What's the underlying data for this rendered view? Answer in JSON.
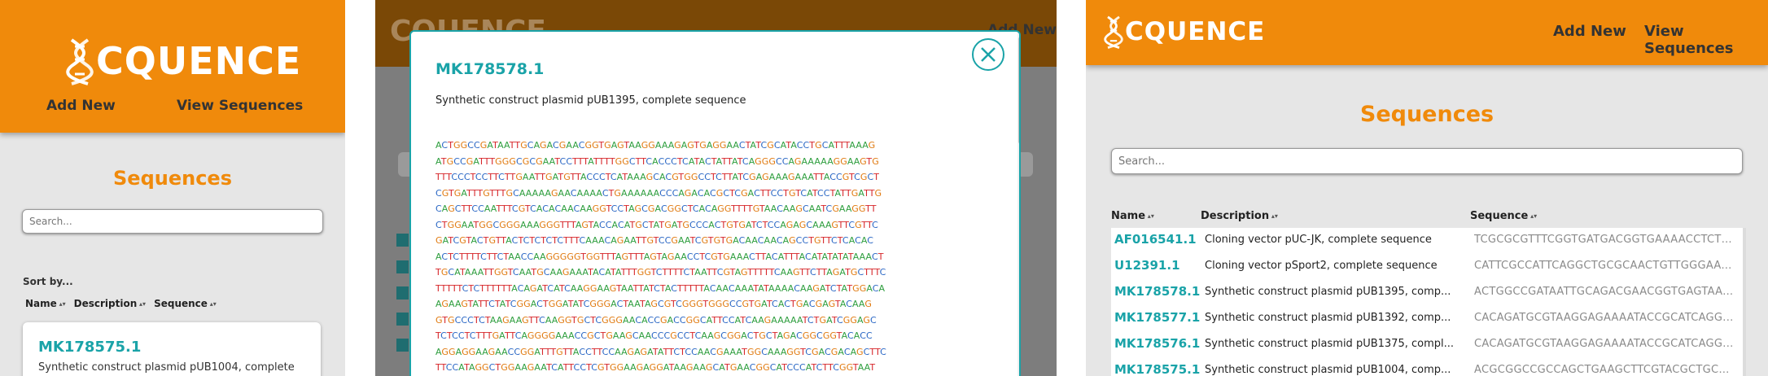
{
  "brand": {
    "name": "CQUENCE",
    "accent": "#f08a0b",
    "teal": "#1aa3a8"
  },
  "nav": {
    "add_new": "Add New",
    "view_sequences": "View Sequences"
  },
  "page": {
    "title": "Sequences",
    "search_placeholder": "Search..."
  },
  "sort": {
    "label": "Sort by...",
    "name": "Name",
    "description": "Description",
    "sequence": "Sequence"
  },
  "mobile_card": {
    "name": "MK178575.1",
    "description": "Synthetic construct plasmid pUB1004, complete"
  },
  "modal": {
    "name": "MK178578.1",
    "description": "Synthetic construct plasmid pUB1395, complete sequence",
    "sequence_lines": [
      "ACTGGCCGATAATTGCAGACGAACGGTGAGTAAGGAAAGAGTGAGGAACTATCGCATACCTGCATTTAAAG",
      "ATGCCGATTTGGGCGCGAATCCTTTATTTTGGCTTCACCCTCATACTATTATCAGGGCCAGAAAAAGGAAGTG",
      "TTTCCCTCCTTCTTGAATTGATGTTACCCTCATAAAGCACGTGGCCTCTTATCGAGAAAGAAATTACCGTCGCT",
      "CGTGATTTGTTTGCAAAAAGAACAAAACTGAAAAAACCCAGACACGCTCGACTTCCTGTCATCCTATTGATTG",
      "CAGCTTCCAATTTCGTCACACAACAAGGTCCTAGCGACGGCTCACAGGTTTTGTAACAAGCAATCGAAGGTT",
      "CTGGAATGGCGGGAAAGGGTTTAGTACCACATGCTATGATGCCCACTGTGATCTCCAGAGCAAAGTTCGTTC",
      "GATCGTACTGTTACTCTCTCTCTTTCAAACAGAATTGTCCGAATCGTGTGACAACAACAGCCTGTTCTCACAC",
      "ACTCTTTTCTTCTAACCAAGGGGGTGGTTTAGTTTAGTAGAACCTCGTGAAACTTACATTTACATATATATAAACT",
      "TGCATAAATTGGTCAATGCAAGAAATACATATTTGGTCTTTTCTAATTCGTAGTTTTTCAAGTTCTTAGATGCTTTC",
      "TTTTTCTCTTTTTTACAGATCATCAAGGAAGTAATTATCTACTTTTTACAACAAATATAAAACAAGATCTATGGACA",
      "AGAAGTATTCTATCGGACTGGATATCGGGACTAATAGCGTCGGGTGGGCCGTGATCACTGACGAGTACAAG",
      "GTGCCCTCTAAGAAGTTCAAGGTGCTCGGGAACACCGACCGGCATTCCATCAAGAAAAATCTGATCGGAGC",
      "TCTCCTCTTTGATTCAGGGGAAACCGCTGAAGCAACCCGCCTCAAGCGGACTGCTAGACGGCGGTACACC",
      "AGGAGGAAGAACCGGATTTGTTACCTTCCAAGAGATATTCTCCAACGAAATGGCAAAGGTCGACGACAGCTTC",
      "TTCCATAGGCTGGAAGAATCATTCCTCGTGGAAGAGGATAAGAAGCATGAACGGCATCCCATCTTCGGTAAT"
    ]
  },
  "table": {
    "headers": {
      "name": "Name",
      "description": "Description",
      "sequence": "Sequence"
    },
    "rows": [
      {
        "name": "AF016541.1",
        "description": "Cloning vector pUC-JK, complete sequence",
        "sequence": "TCGCGCGTTTCGGTGATGACGGTGAAAACCTCTG..."
      },
      {
        "name": "U12391.1",
        "description": "Cloning vector pSport2, complete sequence",
        "sequence": "CATTCGCCATTCAGGCTGCGCAACTGTTGGGAAG..."
      },
      {
        "name": "MK178578.1",
        "description": "Synthetic construct plasmid pUB1395, comp...",
        "sequence": "ACTGGCCGATAATTGCAGACGAACGGTGAGTAAG..."
      },
      {
        "name": "MK178577.1",
        "description": "Synthetic construct plasmid pUB1392, comp...",
        "sequence": "CACAGATGCGTAAGGAGAAAATACCGCATCAGG..."
      },
      {
        "name": "MK178576.1",
        "description": "Synthetic construct plasmid pUB1375, compl...",
        "sequence": "CACAGATGCGTAAGGAGAAAATACCGCATCAGG..."
      },
      {
        "name": "MK178575.1",
        "description": "Synthetic construct plasmid pUB1004, comp...",
        "sequence": "ACGCGGCCGCCAGCTGAAGCTTCGTACGCTGCA..."
      }
    ]
  }
}
